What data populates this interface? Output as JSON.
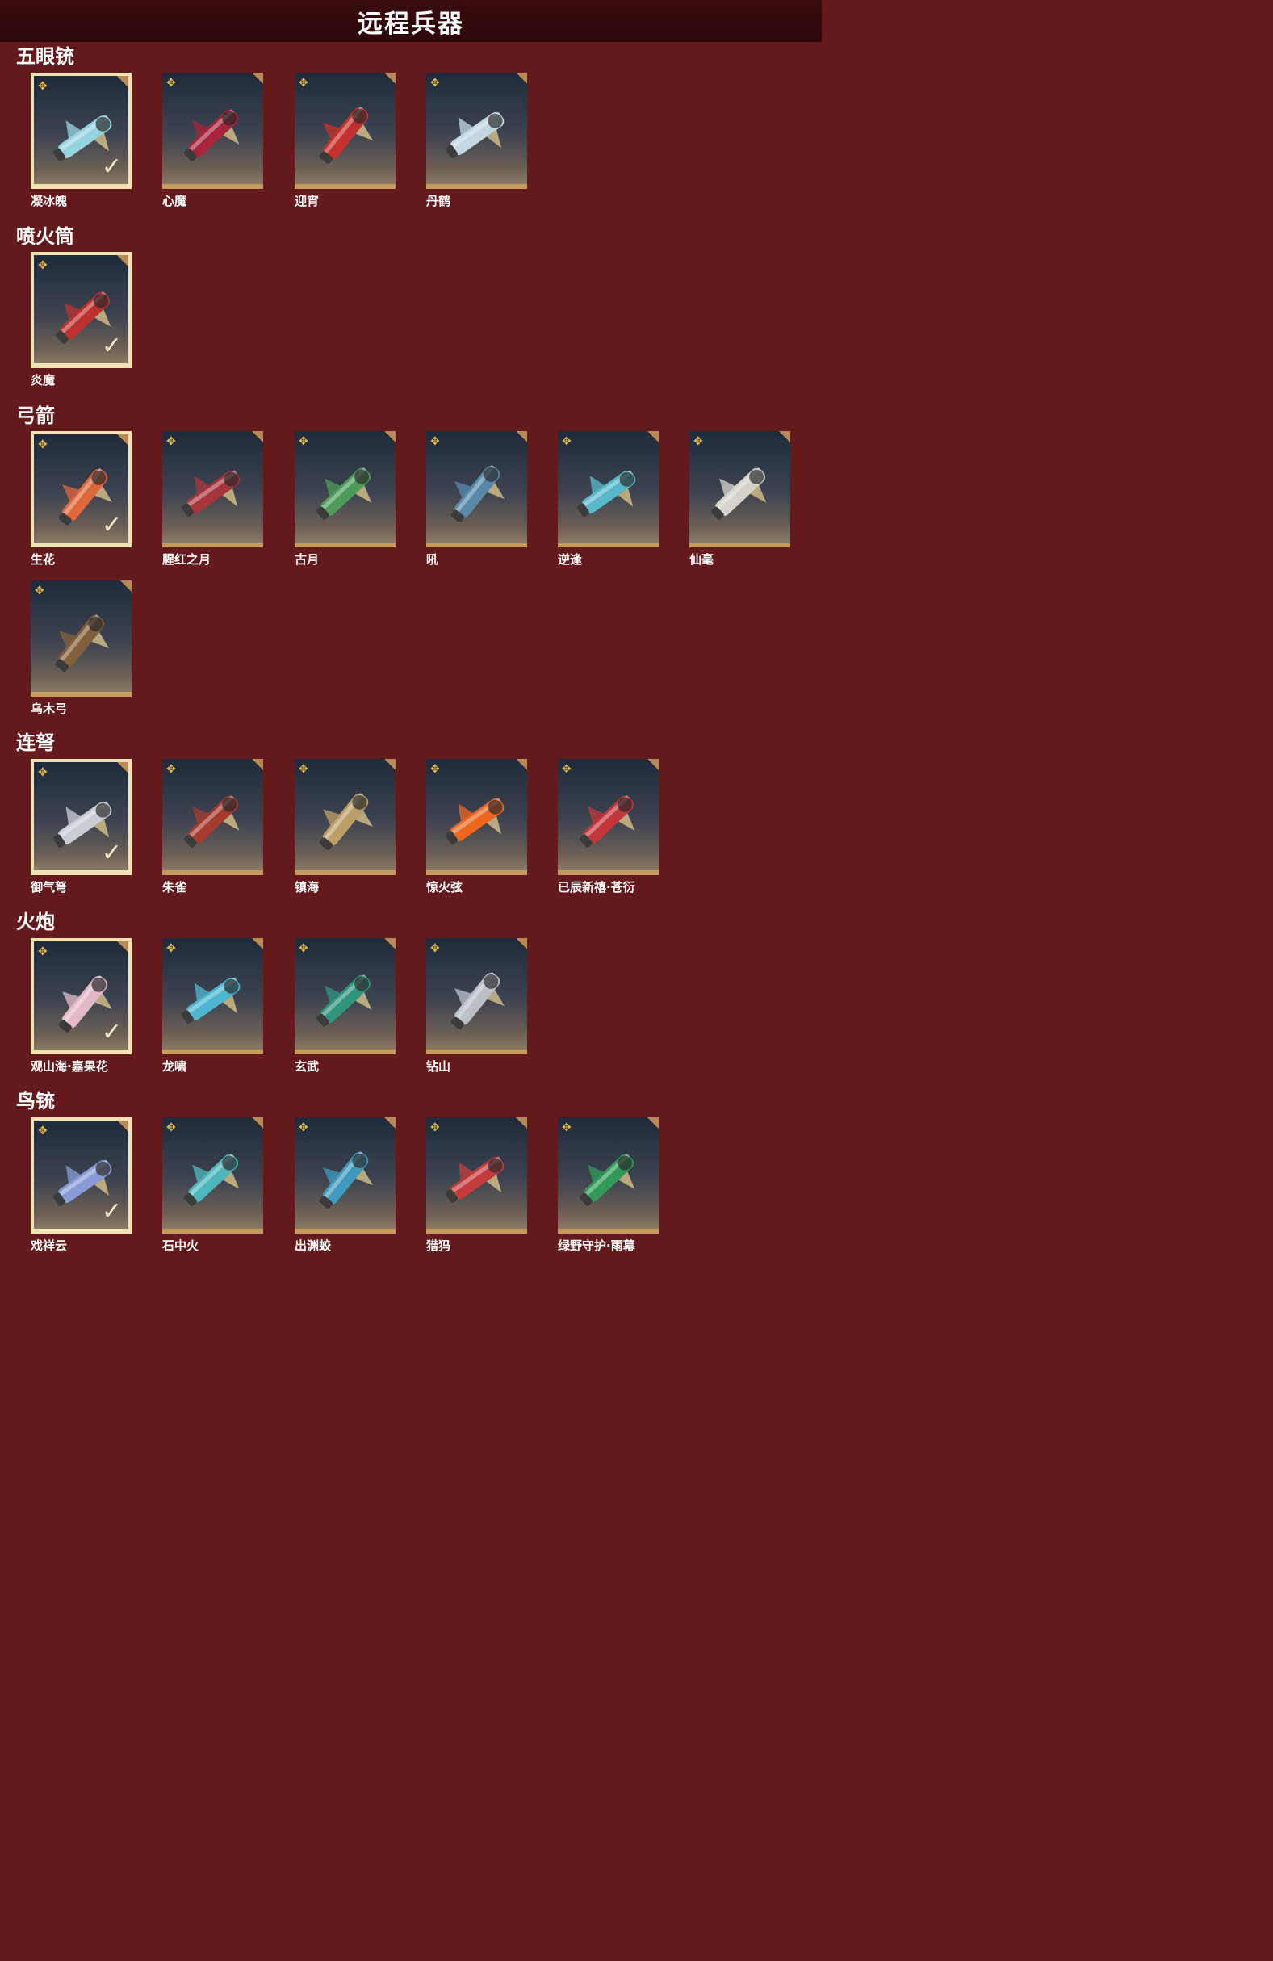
{
  "page": {
    "title": "远程兵器"
  },
  "colors": {
    "background": "#64191d",
    "header": "#2b0709",
    "frame": "#c79a5e",
    "selected_frame": "#f2e1b3",
    "star": "#e8b94a"
  },
  "sections": [
    {
      "title": "五眼铳",
      "items": [
        {
          "name": "凝冰魄",
          "selected": true,
          "tint": "#9fe3f0"
        },
        {
          "name": "心魔",
          "selected": false,
          "tint": "#b3203a"
        },
        {
          "name": "迎宵",
          "selected": false,
          "tint": "#d22f2a"
        },
        {
          "name": "丹鹤",
          "selected": false,
          "tint": "#cfe8f2"
        }
      ]
    },
    {
      "title": "喷火筒",
      "items": [
        {
          "name": "炎魔",
          "selected": true,
          "tint": "#c9302c"
        }
      ]
    },
    {
      "title": "弓箭",
      "items": [
        {
          "name": "生花",
          "selected": true,
          "tint": "#f06a3a"
        },
        {
          "name": "腥红之月",
          "selected": false,
          "tint": "#b1343a"
        },
        {
          "name": "古月",
          "selected": false,
          "tint": "#4fa35a"
        },
        {
          "name": "吼",
          "selected": false,
          "tint": "#5a8fb3"
        },
        {
          "name": "逆逢",
          "selected": false,
          "tint": "#5bc4d6"
        },
        {
          "name": "仙毫",
          "selected": false,
          "tint": "#e6e2d8"
        },
        {
          "name": "乌木弓",
          "selected": false,
          "tint": "#8a6238"
        }
      ]
    },
    {
      "title": "连弩",
      "items": [
        {
          "name": "御气弩",
          "selected": true,
          "tint": "#d8dbe2"
        },
        {
          "name": "朱雀",
          "selected": false,
          "tint": "#b03a2b"
        },
        {
          "name": "镇海",
          "selected": false,
          "tint": "#c9a76a"
        },
        {
          "name": "惊火弦",
          "selected": false,
          "tint": "#ff6a1a"
        },
        {
          "name": "已辰新禧·苍衍",
          "selected": false,
          "tint": "#d0343a"
        }
      ]
    },
    {
      "title": "火炮",
      "items": [
        {
          "name": "观山海·嘉果花",
          "selected": true,
          "tint": "#f4c4d4"
        },
        {
          "name": "龙啸",
          "selected": false,
          "tint": "#4fc3dd"
        },
        {
          "name": "玄武",
          "selected": false,
          "tint": "#2f9c82"
        },
        {
          "name": "钻山",
          "selected": false,
          "tint": "#c8ccd6"
        }
      ]
    },
    {
      "title": "鸟铳",
      "items": [
        {
          "name": "戏祥云",
          "selected": true,
          "tint": "#8fa4e6"
        },
        {
          "name": "石中火",
          "selected": false,
          "tint": "#4fc3c9"
        },
        {
          "name": "出渊蛟",
          "selected": false,
          "tint": "#3fa3c9"
        },
        {
          "name": "猎犸",
          "selected": false,
          "tint": "#d23a3a"
        },
        {
          "name": "绿野守护·雨幕",
          "selected": false,
          "tint": "#2fa35a"
        }
      ]
    }
  ]
}
